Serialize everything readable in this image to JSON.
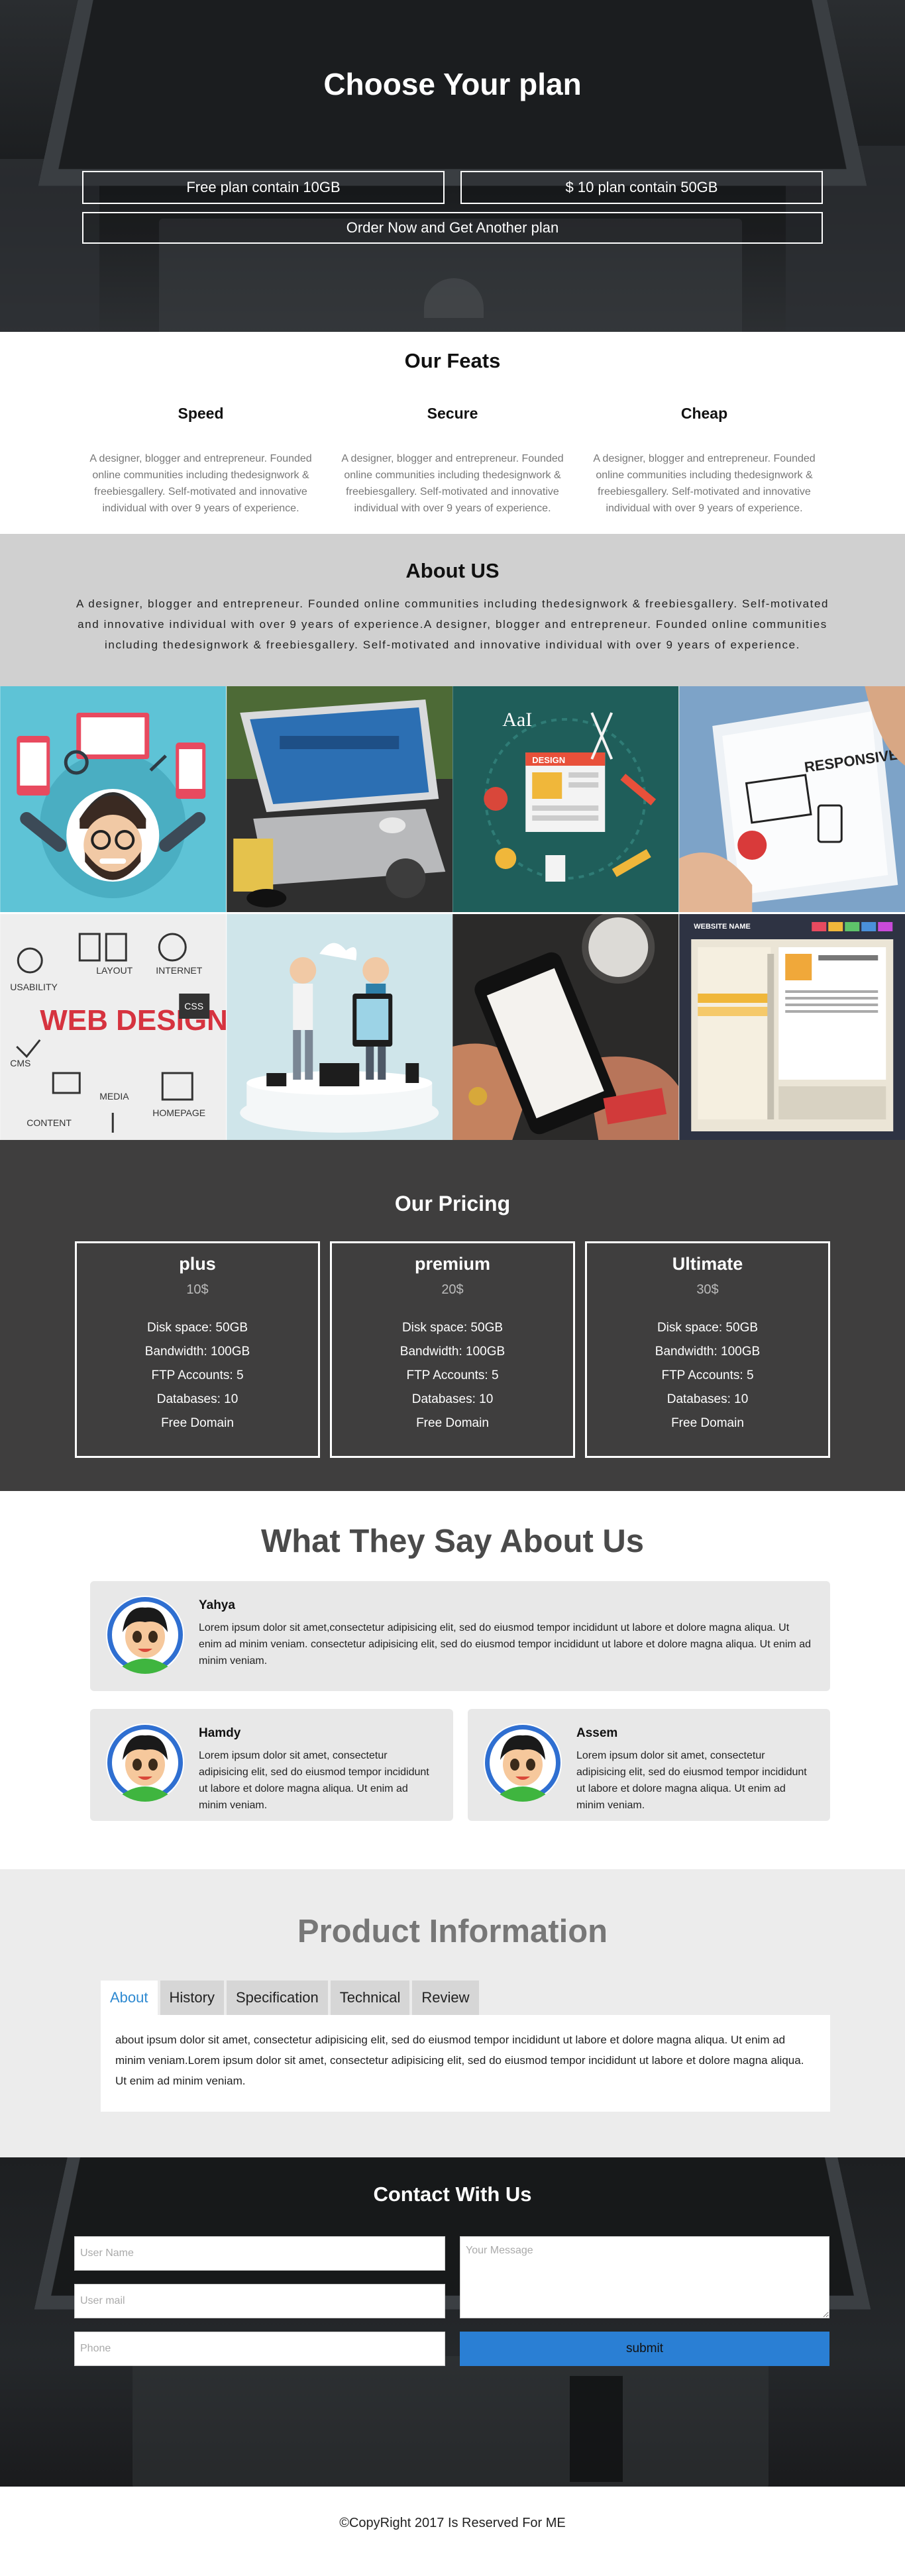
{
  "hero": {
    "title": "Choose Your plan",
    "plans": [
      "Free plan contain 10GB",
      "$ 10 plan contain 50GB"
    ],
    "order_label": "Order Now and Get Another plan"
  },
  "feats": {
    "title": "Our Feats",
    "items": [
      {
        "title": "Speed",
        "text": "A designer, blogger and entrepreneur. Founded online communities including thedesignwork & freebiesgallery. Self-motivated and innovative individual with over 9 years of experience."
      },
      {
        "title": "Secure",
        "text": "A designer, blogger and entrepreneur. Founded online communities including thedesignwork & freebiesgallery. Self-motivated and innovative individual with over 9 years of experience."
      },
      {
        "title": "Cheap",
        "text": "A designer, blogger and entrepreneur. Founded online communities including thedesignwork & freebiesgallery. Self-motivated and innovative individual with over 9 years of experience."
      }
    ]
  },
  "about": {
    "title": "About US",
    "text": "A designer, blogger and entrepreneur. Founded online communities including thedesignwork & freebiesgallery. Self-motivated and innovative individual with over 9 years of experience.A designer, blogger and entrepreneur. Founded online communities including thedesignwork & freebiesgallery. Self-motivated and innovative individual with over 9 years of experience."
  },
  "gallery": {
    "tile3_text": "AaI",
    "tile3_design": "DESIGN",
    "tile4_text": "RESPONSIVE DESIGN",
    "tile5_main": "WEB DESIGN",
    "tile5_words": [
      "USABILITY",
      "LAYOUT",
      "INTERNET",
      "CSS",
      "CMS",
      "MEDIA",
      "CONTENT",
      "HOMEPAGE"
    ],
    "tile8_header": "WEBSITE NAME"
  },
  "pricing": {
    "title": "Our Pricing",
    "plans": [
      {
        "name": "plus",
        "price": "10$",
        "features": [
          "Disk space: 50GB",
          "Bandwidth: 100GB",
          "FTP Accounts: 5",
          "Databases: 10",
          "Free Domain"
        ]
      },
      {
        "name": "premium",
        "price": "20$",
        "features": [
          "Disk space: 50GB",
          "Bandwidth: 100GB",
          "FTP Accounts: 5",
          "Databases: 10",
          "Free Domain"
        ]
      },
      {
        "name": "Ultimate",
        "price": "30$",
        "features": [
          "Disk space: 50GB",
          "Bandwidth: 100GB",
          "FTP Accounts: 5",
          "Databases: 10",
          "Free Domain"
        ]
      }
    ]
  },
  "testimonials": {
    "title": "What They Say About Us",
    "items": [
      {
        "name": "Yahya",
        "text": "Lorem ipsum dolor sit amet,consectetur adipisicing elit, sed do eiusmod tempor incididunt ut labore et dolore magna aliqua. Ut enim ad minim veniam. consectetur adipisicing elit, sed do eiusmod tempor incididunt ut labore et dolore magna aliqua. Ut enim ad minim veniam."
      },
      {
        "name": "Hamdy",
        "text": "Lorem ipsum dolor sit amet, consectetur adipisicing elit, sed do eiusmod tempor incididunt ut labore et dolore magna aliqua. Ut enim ad minim veniam."
      },
      {
        "name": "Assem",
        "text": "Lorem ipsum dolor sit amet, consectetur adipisicing elit, sed do eiusmod tempor incididunt ut labore et dolore magna aliqua. Ut enim ad minim veniam."
      }
    ]
  },
  "product": {
    "title": "Product Information",
    "tabs": [
      "About",
      "History",
      "Specification",
      "Technical",
      "Review"
    ],
    "active_tab": "About",
    "content": "about ipsum dolor sit amet, consectetur adipisicing elit, sed do eiusmod tempor incididunt ut labore et dolore magna aliqua. Ut enim ad minim veniam.Lorem ipsum dolor sit amet, consectetur adipisicing elit, sed do eiusmod tempor incididunt ut labore et dolore magna aliqua. Ut enim ad minim veniam."
  },
  "contact": {
    "title": "Contact With Us",
    "name_placeholder": "User Name",
    "mail_placeholder": "User mail",
    "phone_placeholder": "Phone",
    "message_placeholder": "Your Message",
    "submit_label": "submit",
    "submit_color": "#2a7fd4"
  },
  "footer": {
    "copyright": "©CopyRight 2017 Is Reserved For ME"
  }
}
